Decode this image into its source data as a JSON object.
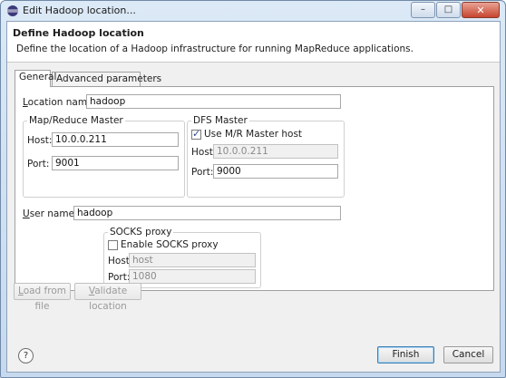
{
  "window": {
    "title": "Edit Hadoop location...",
    "controls": {
      "minimize": "–",
      "maximize": "□",
      "close": "✕"
    }
  },
  "header": {
    "title": "Define Hadoop location",
    "description": "Define the location of a Hadoop infrastructure for running MapReduce applications."
  },
  "tabs": [
    {
      "label": "General",
      "active": true
    },
    {
      "label": "Advanced parameters",
      "active": false
    }
  ],
  "general": {
    "location_name": {
      "label_prefix": "L",
      "label_rest": "ocation name:",
      "value": "hadoop"
    },
    "mapred_master": {
      "title": "Map/Reduce Master",
      "host_label": "Host:",
      "host_value": "10.0.0.211",
      "port_label": "Port:",
      "port_value": "9001"
    },
    "dfs_master": {
      "title": "DFS Master",
      "use_mr_label": "Use M/R Master host",
      "use_mr_checked": true,
      "host_label": "Host:",
      "host_value": "10.0.0.211",
      "port_label": "Port:",
      "port_value": "9000"
    },
    "user_name": {
      "label_prefix": "U",
      "label_rest": "ser name:",
      "value": "hadoop"
    },
    "socks_proxy": {
      "title": "SOCKS proxy",
      "enable_label": "Enable SOCKS proxy",
      "enable_checked": false,
      "host_label": "Host:",
      "host_value": "host",
      "port_label": "Port:",
      "port_value": "1080"
    }
  },
  "actions": {
    "load_from_file": {
      "prefix": "L",
      "rest": "oad from file"
    },
    "validate_location": {
      "prefix": "V",
      "rest": "alidate location"
    }
  },
  "footer": {
    "help": "?",
    "finish": "Finish",
    "cancel": "Cancel"
  },
  "colors": {
    "accent": "#3c7fb1",
    "window_frame": "#c6d9ee",
    "close_button": "#c7452f"
  }
}
